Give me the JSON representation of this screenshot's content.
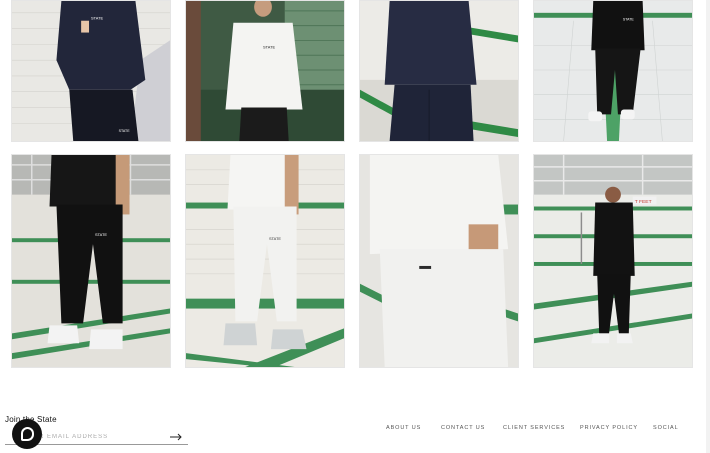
{
  "gallery": {
    "photos": [
      {
        "label": "Model in navy hoodie and black joggers against white tiled wall",
        "chest_logo": "STATE",
        "leg_logo": "STATE"
      },
      {
        "label": "Model in white hoodie against green tiled railing",
        "chest_logo": "STATE"
      },
      {
        "label": "Close-up of navy hoodie and navy joggers"
      },
      {
        "label": "Model in black sweatshirt and black joggers in tiled pool",
        "chest_logo": "STATE"
      },
      {
        "label": "Black t-shirt and black joggers with white sneakers",
        "leg_logo": "STATE"
      },
      {
        "label": "White t-shirt and white joggers with sneakers",
        "leg_logo": "STATE"
      },
      {
        "label": "Close-up of white t-shirt and white joggers pocket"
      },
      {
        "label": "Model in black t-shirt and black joggers in empty pool",
        "sign_text": "T FEET"
      }
    ]
  },
  "footer": {
    "newsletter_title": "Join the State",
    "email_placeholder": "YOUR EMAIL ADDRESS",
    "submit_icon": "arrow-right-icon",
    "chat_icon": "chat-bubble-icon",
    "links": [
      "ABOUT US",
      "CONTACT US",
      "CLIENT SERVICES",
      "PRIVACY POLICY",
      "SOCIAL"
    ]
  }
}
